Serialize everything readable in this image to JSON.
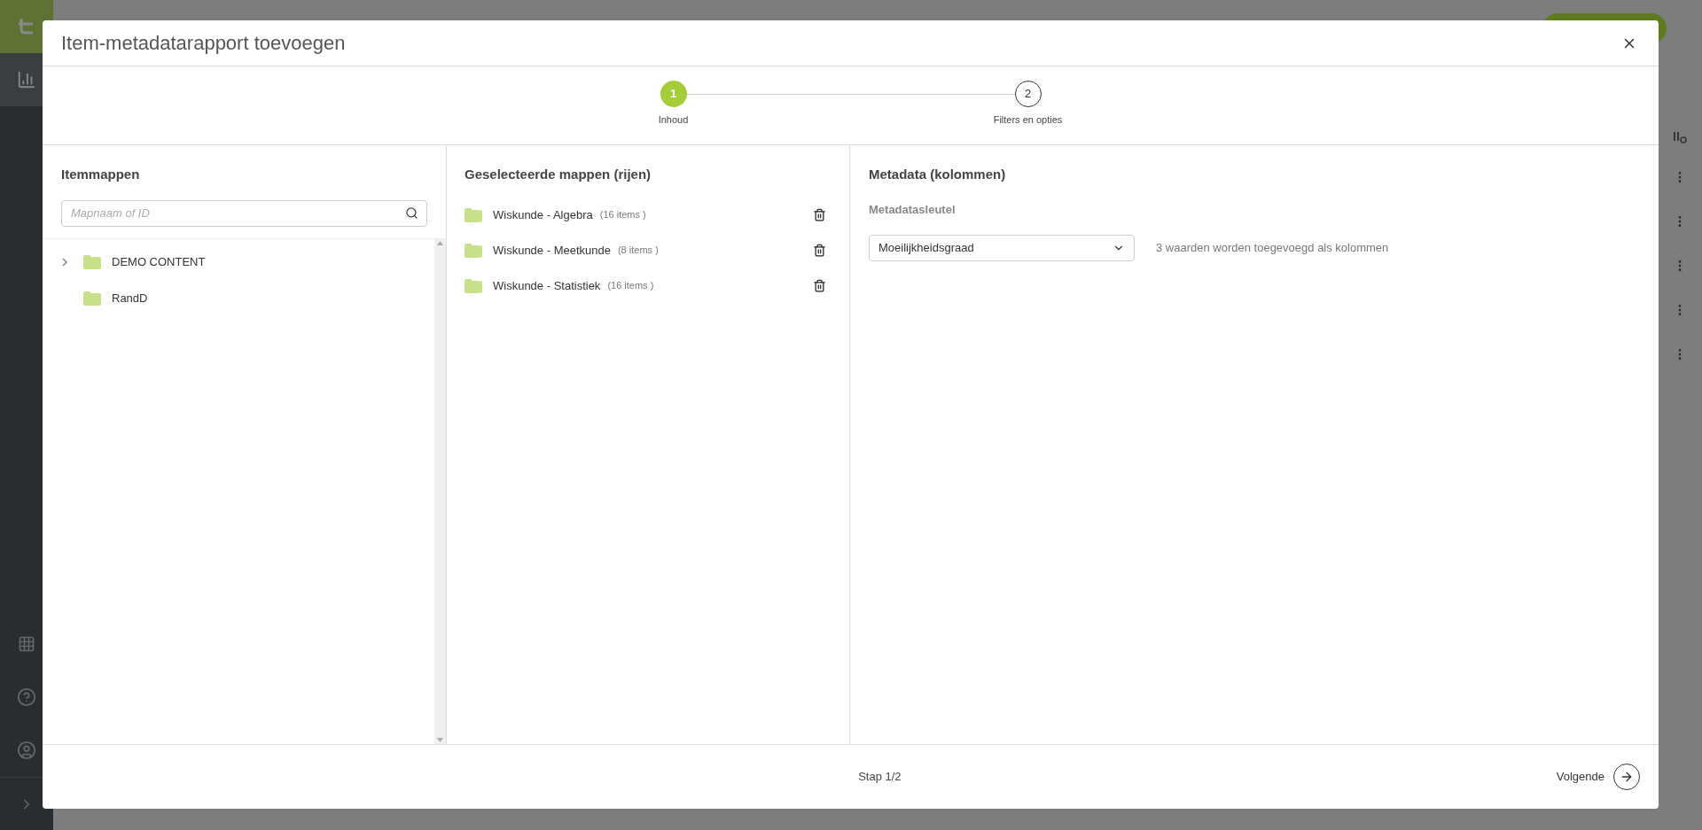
{
  "dialog": {
    "title": "Item-metadatarapport toevoegen"
  },
  "stepper": [
    {
      "number": "1",
      "label": "Inhoud",
      "selected": true
    },
    {
      "number": "2",
      "label": "Filters en opties",
      "selected": false
    }
  ],
  "folders_panel": {
    "title": "Itemmappen",
    "search": {
      "placeholder": "Mapnaam of ID"
    },
    "tree": [
      {
        "name": "DEMO CONTENT",
        "expanded": false
      },
      {
        "name": "RandD"
      }
    ]
  },
  "selected_panel": {
    "title": "Geselecteerde mappen (rijen)",
    "rows": [
      {
        "name": "Wiskunde - Algebra",
        "count": "(16 items )"
      },
      {
        "name": "Wiskunde - Meetkunde",
        "count": "(8 items )"
      },
      {
        "name": "Wiskunde - Statistiek",
        "count": "(16 items )"
      }
    ]
  },
  "metadata_panel": {
    "title": "Metadata (kolommen)",
    "key_label": "Metadatasleutel",
    "select_value": "Moeilijkheidsgraad",
    "hint": "3 waarden worden toegevoegd als kolommen"
  },
  "footer": {
    "step": "Stap 1/2",
    "next": "Volgende"
  }
}
